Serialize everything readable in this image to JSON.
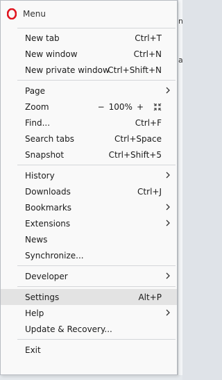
{
  "menu": {
    "title": "Menu",
    "logo_color": "#e0141e",
    "highlight_color": "#e3e3e3",
    "groups": [
      [
        {
          "label": "New tab",
          "shortcut": "Ctrl+T"
        },
        {
          "label": "New window",
          "shortcut": "Ctrl+N"
        },
        {
          "label": "New private window",
          "shortcut": "Ctrl+Shift+N"
        }
      ],
      [
        {
          "label": "Page",
          "submenu": true
        },
        {
          "label": "Zoom",
          "zoom": {
            "minus": "−",
            "value": "100%",
            "plus": "+",
            "fullscreen_icon": "fullscreen-icon"
          }
        },
        {
          "label": "Find...",
          "shortcut": "Ctrl+F"
        },
        {
          "label": "Search tabs",
          "shortcut": "Ctrl+Space"
        },
        {
          "label": "Snapshot",
          "shortcut": "Ctrl+Shift+5"
        }
      ],
      [
        {
          "label": "History",
          "submenu": true
        },
        {
          "label": "Downloads",
          "shortcut": "Ctrl+J"
        },
        {
          "label": "Bookmarks",
          "submenu": true
        },
        {
          "label": "Extensions",
          "submenu": true
        },
        {
          "label": "News"
        },
        {
          "label": "Synchronize..."
        }
      ],
      [
        {
          "label": "Developer",
          "submenu": true
        }
      ],
      [
        {
          "label": "Settings",
          "shortcut": "Alt+P",
          "highlighted": true
        },
        {
          "label": "Help",
          "submenu": true
        },
        {
          "label": "Update & Recovery..."
        }
      ],
      [
        {
          "label": "Exit"
        }
      ]
    ]
  },
  "background": {
    "fragments": [
      "ng",
      "ala"
    ]
  }
}
